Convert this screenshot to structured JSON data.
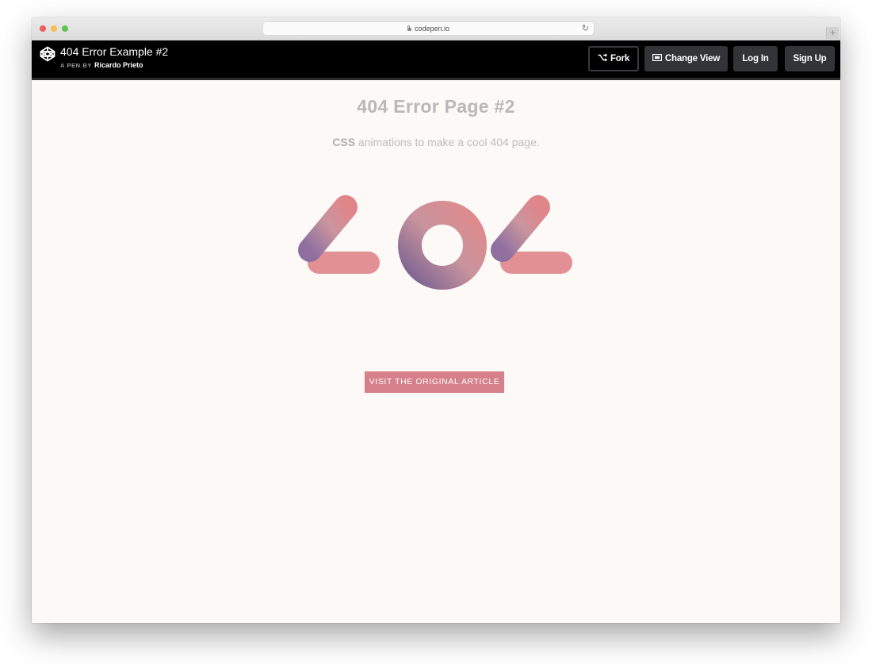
{
  "browser": {
    "url": "codepen.io",
    "lock_icon": "lock-icon",
    "reload_icon": "reload-icon",
    "new_tab_icon": "plus-icon",
    "new_tab_symbol": "+",
    "reload_symbol": "↻"
  },
  "codepen_header": {
    "logo_icon": "codepen-logo-icon",
    "pen_title": "404 Error Example #2",
    "byline_prefix": "A PEN BY",
    "author": "Ricardo Prieto",
    "buttons": {
      "fork": "Fork",
      "change_view": "Change View",
      "log_in": "Log In",
      "sign_up": "Sign Up"
    }
  },
  "page": {
    "heading": "404 Error Page #2",
    "subtitle_bold": "CSS",
    "subtitle_rest": " animations to make a cool 404 page.",
    "art_text": "404",
    "cta_label": "VISIT THE ORIGINAL ARTICLE",
    "colors": {
      "pink": "#e0858a",
      "purple": "#8e6fa0",
      "button": "#d5808a",
      "background": "#fcf9f6"
    }
  }
}
